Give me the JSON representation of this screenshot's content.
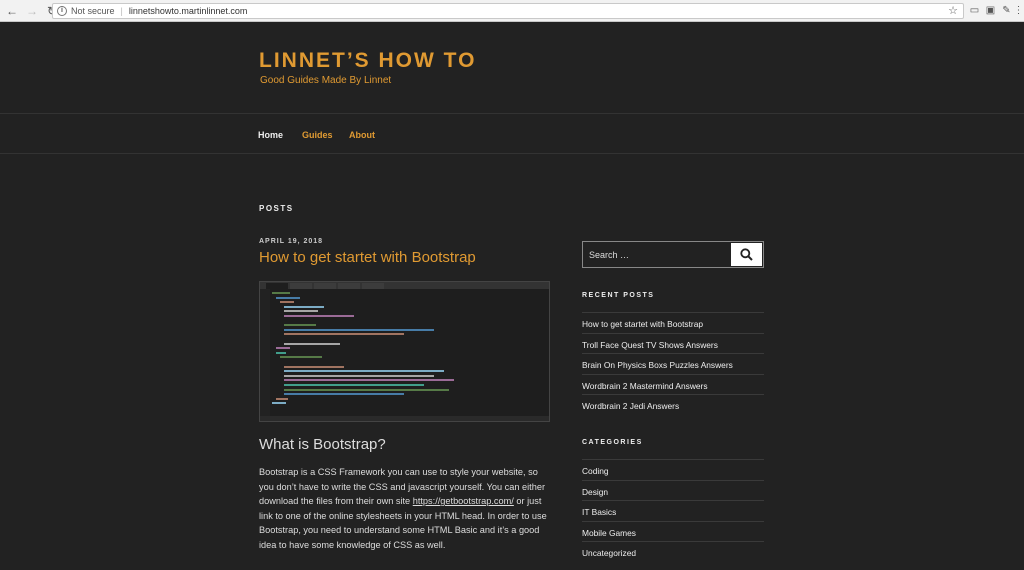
{
  "browser": {
    "security_label": "Not secure",
    "url": "linnetshowto.martinlinnet.com",
    "back_icon": "arrow-left-icon",
    "forward_icon": "arrow-right-icon",
    "reload_icon": "reload-icon",
    "star_icon": "star-icon"
  },
  "site": {
    "title": "LINNET’S HOW TO",
    "description": "Good Guides Made By Linnet",
    "accent_color": "#e09a32"
  },
  "nav": {
    "items": [
      {
        "label": "Home"
      },
      {
        "label": "Guides"
      },
      {
        "label": "About"
      }
    ]
  },
  "main": {
    "section_label": "POSTS",
    "post": {
      "date": "APRIL 19, 2018",
      "title": "How to get startet with Bootstrap",
      "heading": "What is Bootstrap?",
      "paragraph_before_link": "Bootstrap is a CSS Framework you can use to style your website, so you don’t have to write the CSS and javascript yourself. You can either download the files from their own site ",
      "link_text": "https://getbootstrap.com/",
      "paragraph_after_link": " or just link to one of the online stylesheets in your HTML head. In order to use Bootstrap, you need to understand some HTML Basic and it’s a good idea to have some knowledge of CSS as well."
    }
  },
  "sidebar": {
    "search_placeholder": "Search …",
    "recent_posts_title": "RECENT POSTS",
    "recent_posts": [
      "How to get startet with Bootstrap",
      "Troll Face Quest TV Shows Answers",
      "Brain On Physics Boxs Puzzles Answers",
      "Wordbrain 2 Mastermind Answers",
      "Wordbrain 2 Jedi Answers"
    ],
    "categories_title": "CATEGORIES",
    "categories": [
      "Coding",
      "Design",
      "IT Basics",
      "Mobile Games",
      "Uncategorized"
    ]
  }
}
